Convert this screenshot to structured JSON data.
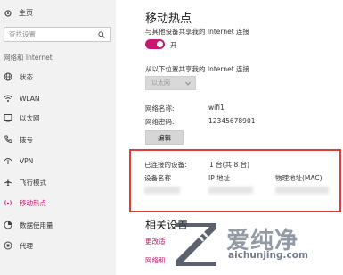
{
  "sidebar": {
    "home_label": "主页",
    "search_placeholder": "查找设置",
    "section_label": "网络和 Internet",
    "items": [
      {
        "label": "状态",
        "icon": "globe-icon"
      },
      {
        "label": "WLAN",
        "icon": "wifi-icon"
      },
      {
        "label": "以太网",
        "icon": "ethernet-icon"
      },
      {
        "label": "拨号",
        "icon": "phone-icon"
      },
      {
        "label": "VPN",
        "icon": "vpn-icon"
      },
      {
        "label": "飞行模式",
        "icon": "airplane-icon"
      },
      {
        "label": "移动热点",
        "icon": "hotspot-icon",
        "active": true
      },
      {
        "label": "数据使用量",
        "icon": "data-usage-icon"
      },
      {
        "label": "代理",
        "icon": "proxy-icon"
      }
    ]
  },
  "main": {
    "title": "移动热点",
    "share_label": "与其他设备共享我的 Internet 连接",
    "toggle_state": "开",
    "from_label": "从以下位置共享我的 Internet 连接",
    "dropdown_value": "以太网",
    "network_name_label": "网络名称:",
    "network_name_value": "wifi1",
    "network_password_label": "网络密码:",
    "network_password_value": "12345678901",
    "edit_button": "编辑",
    "connected_label": "已连接的设备:",
    "connected_value": "1 台(共 8 台)",
    "columns": [
      "设备名称",
      "IP 地址",
      "物理地址(MAC)"
    ],
    "related_title": "相关设置",
    "links": [
      "更改适",
      "网络和"
    ]
  },
  "watermark": {
    "text": "爱纯净",
    "url": "aichunjing.com"
  },
  "colors": {
    "accent": "#c7176f",
    "highlight_border": "#e03b3b"
  }
}
